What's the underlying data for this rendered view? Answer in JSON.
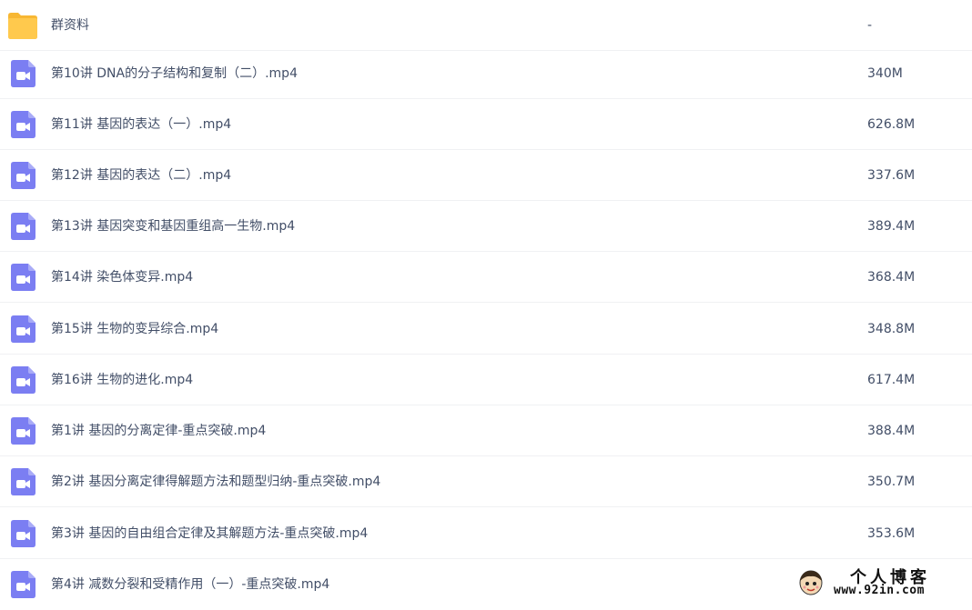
{
  "files": [
    {
      "name": "群资料",
      "size": "-",
      "icon": "folder-icon"
    },
    {
      "name": "第10讲 DNA的分子结构和复制（二）.mp4",
      "size": "340M",
      "icon": "video-file-icon"
    },
    {
      "name": "第11讲 基因的表达（一）.mp4",
      "size": "626.8M",
      "icon": "video-file-icon"
    },
    {
      "name": "第12讲 基因的表达（二）.mp4",
      "size": "337.6M",
      "icon": "video-file-icon"
    },
    {
      "name": "第13讲 基因突变和基因重组高一生物.mp4",
      "size": "389.4M",
      "icon": "video-file-icon"
    },
    {
      "name": "第14讲 染色体变异.mp4",
      "size": "368.4M",
      "icon": "video-file-icon"
    },
    {
      "name": "第15讲 生物的变异综合.mp4",
      "size": "348.8M",
      "icon": "video-file-icon"
    },
    {
      "name": "第16讲 生物的进化.mp4",
      "size": "617.4M",
      "icon": "video-file-icon"
    },
    {
      "name": "第1讲 基因的分离定律-重点突破.mp4",
      "size": "388.4M",
      "icon": "video-file-icon"
    },
    {
      "name": "第2讲 基因分离定律得解题方法和题型归纳-重点突破.mp4",
      "size": "350.7M",
      "icon": "video-file-icon"
    },
    {
      "name": "第3讲 基因的自由组合定律及其解题方法-重点突破.mp4",
      "size": "353.6M",
      "icon": "video-file-icon"
    },
    {
      "name": "第4讲 减数分裂和受精作用（一）-重点突破.mp4",
      "size": "",
      "icon": "video-file-icon"
    }
  ],
  "watermark": {
    "title": "个人博客",
    "url": "www.92in.com"
  },
  "colors": {
    "folder": "#ffc94d",
    "video": "#7b7ef2",
    "text": "#424e67",
    "divider": "#f0f1f3"
  }
}
